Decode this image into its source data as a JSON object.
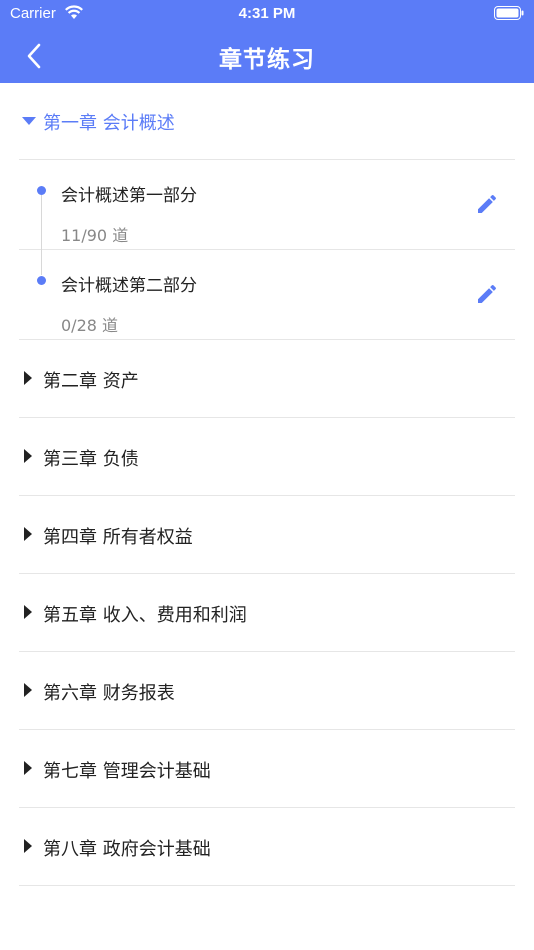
{
  "status": {
    "carrier": "Carrier",
    "time": "4:31 PM"
  },
  "nav": {
    "title": "章节练习"
  },
  "expanded_chapter": {
    "title": "第一章 会计概述",
    "sections": [
      {
        "title": "会计概述第一部分",
        "count": "11/90  道"
      },
      {
        "title": "会计概述第二部分",
        "count": "0/28  道"
      }
    ]
  },
  "chapters": [
    {
      "title": "第二章 资产"
    },
    {
      "title": "第三章 负债"
    },
    {
      "title": "第四章 所有者权益"
    },
    {
      "title": "第五章 收入、费用和利润"
    },
    {
      "title": "第六章 财务报表"
    },
    {
      "title": "第七章 管理会计基础"
    },
    {
      "title": "第八章 政府会计基础"
    }
  ],
  "colors": {
    "accent": "#5B7CF7",
    "text": "#222222",
    "muted": "#888888",
    "divider": "#e6e6e6"
  }
}
